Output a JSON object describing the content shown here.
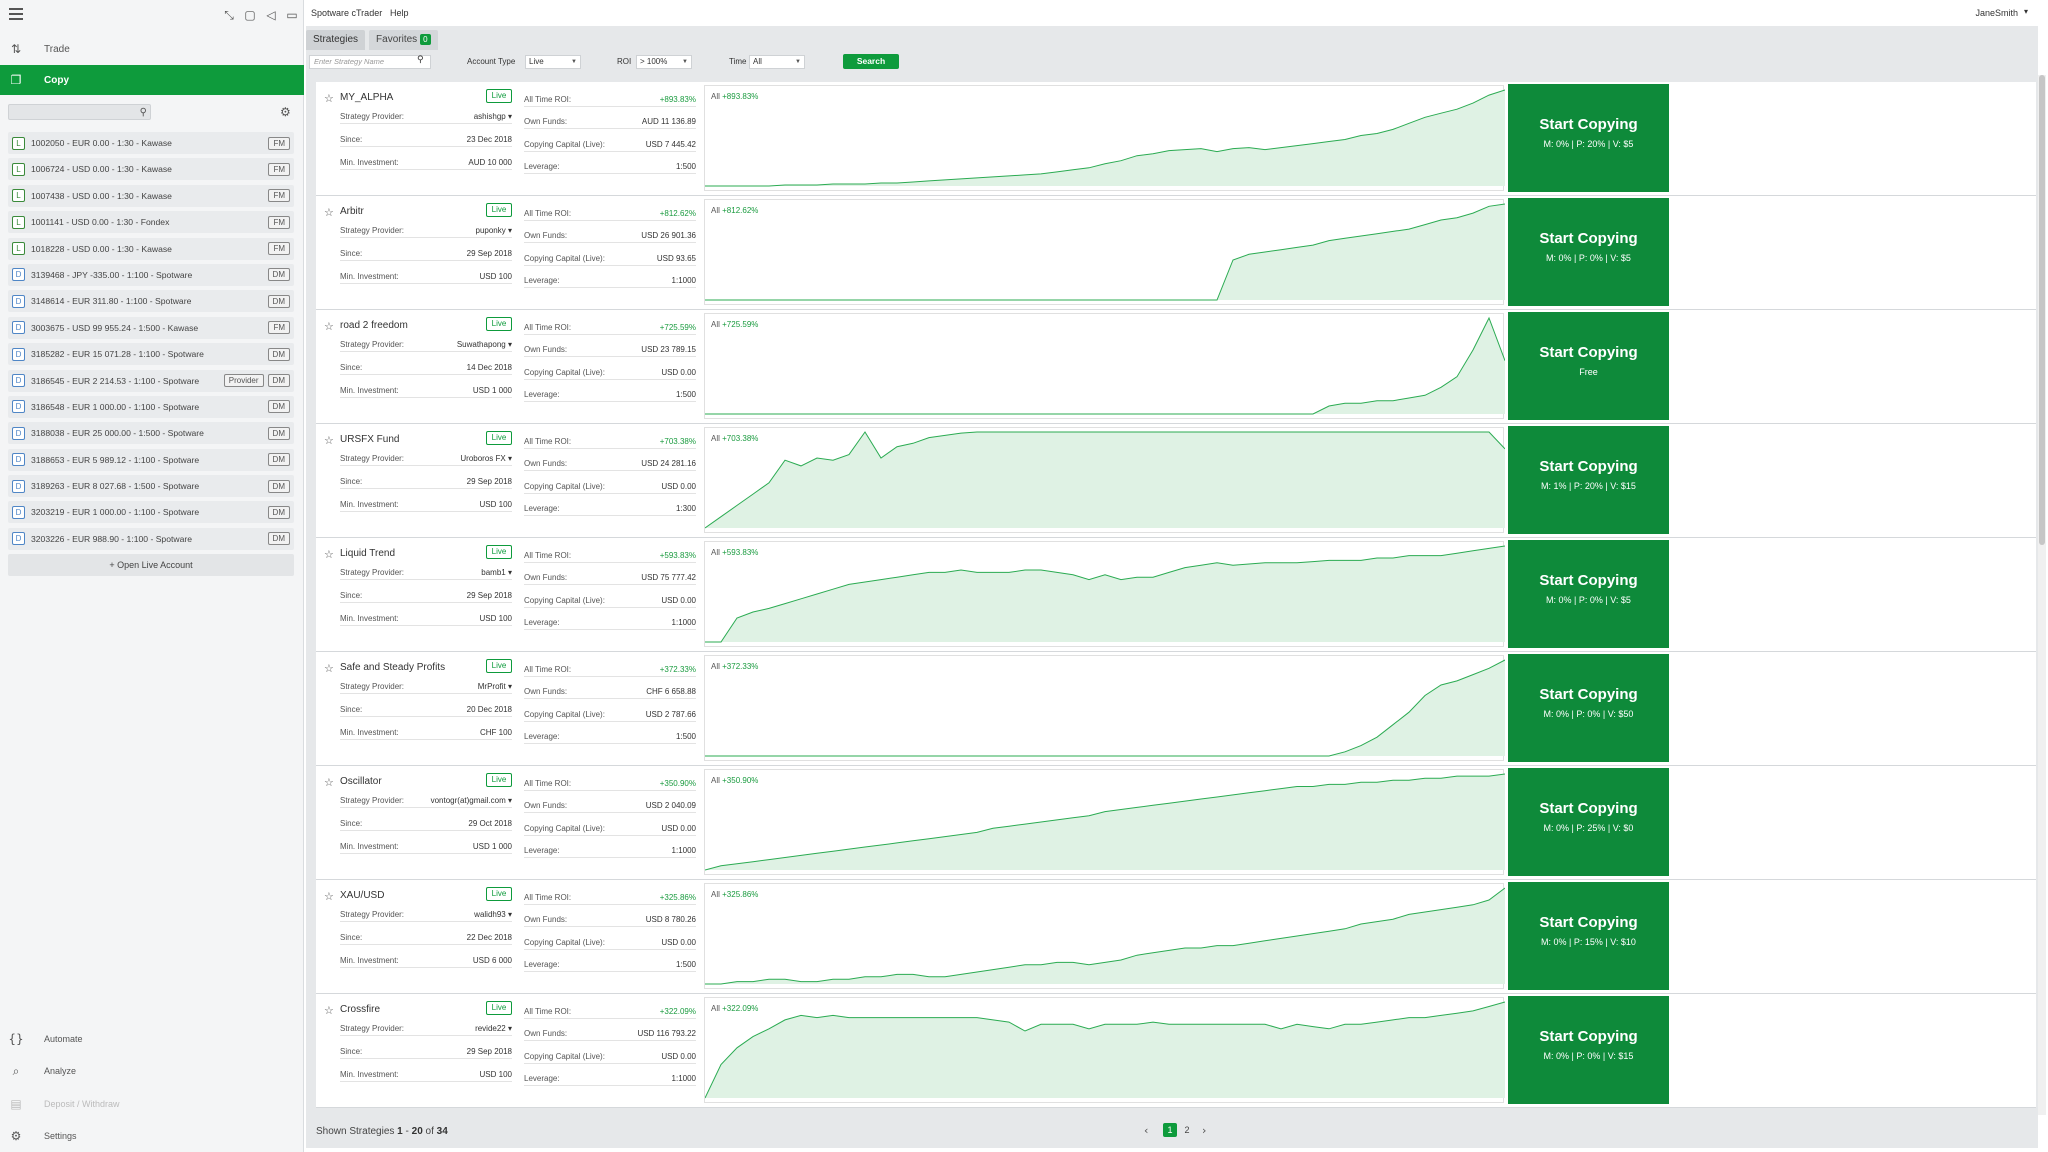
{
  "sidebar": {
    "nav": [
      {
        "label": "Trade",
        "icon": "trade-icon"
      },
      {
        "label": "Copy",
        "icon": "copy-icon"
      }
    ],
    "accounts": [
      {
        "badge": "L",
        "text": "1002050 - EUR 0.00 - 1:30 - Kawase",
        "tag": "FM"
      },
      {
        "badge": "L",
        "text": "1006724 - USD 0.00 - 1:30 - Kawase",
        "tag": "FM"
      },
      {
        "badge": "L",
        "text": "1007438 - USD 0.00 - 1:30 - Kawase",
        "tag": "FM"
      },
      {
        "badge": "L",
        "text": "1001141 - USD 0.00 - 1:30 - Fondex",
        "tag": "FM"
      },
      {
        "badge": "L",
        "text": "1018228 - USD 0.00 - 1:30 - Kawase",
        "tag": "FM"
      },
      {
        "badge": "D",
        "text": "3139468 - JPY -335.00 - 1:100 - Spotware",
        "tag": "DM"
      },
      {
        "badge": "D",
        "text": "3148614 - EUR 311.80 - 1:100 - Spotware",
        "tag": "DM"
      },
      {
        "badge": "D",
        "text": "3003675 - USD 99 955.24 - 1:500 - Kawase",
        "tag": "FM"
      },
      {
        "badge": "D",
        "text": "3185282 - EUR 15 071.28 - 1:100 - Spotware",
        "tag": "DM"
      },
      {
        "badge": "D",
        "text": "3186545 - EUR 2 214.53 - 1:100 - Spotware",
        "tag": "DM",
        "extra": "Provider"
      },
      {
        "badge": "D",
        "text": "3186548 - EUR 1 000.00 - 1:100 - Spotware",
        "tag": "DM"
      },
      {
        "badge": "D",
        "text": "3188038 - EUR 25 000.00 - 1:500 - Spotware",
        "tag": "DM"
      },
      {
        "badge": "D",
        "text": "3188653 - EUR 5 989.12 - 1:100 - Spotware",
        "tag": "DM"
      },
      {
        "badge": "D",
        "text": "3189263 - EUR 8 027.68 - 1:500 - Spotware",
        "tag": "DM"
      },
      {
        "badge": "D",
        "text": "3203219 - EUR 1 000.00 - 1:100 - Spotware",
        "tag": "DM"
      },
      {
        "badge": "D",
        "text": "3203226 - EUR 988.90 - 1:100 - Spotware",
        "tag": "DM"
      }
    ],
    "open_live": "+ Open Live Account",
    "bottom_nav": [
      {
        "label": "Automate",
        "icon": "automate-icon"
      },
      {
        "label": "Analyze",
        "icon": "analyze-icon"
      },
      {
        "label": "Deposit / Withdraw",
        "icon": "deposit-icon"
      },
      {
        "label": "Settings",
        "icon": "settings-icon"
      }
    ]
  },
  "header": {
    "app_title": "Spotware cTrader",
    "help": "Help",
    "user": "JaneSmith"
  },
  "tabs": {
    "strategies": "Strategies",
    "favorites": "Favorites",
    "favorites_count": "0"
  },
  "filters": {
    "name_placeholder": "Enter Strategy Name",
    "account_type_label": "Account Type",
    "account_type_value": "Live",
    "roi_label": "ROI",
    "roi_value": "> 100%",
    "time_label": "Time",
    "time_value": "All",
    "search_label": "Search"
  },
  "labels": {
    "provider": "Strategy Provider:",
    "since": "Since:",
    "min_investment": "Min. Investment:",
    "roi": "All Time ROI:",
    "own_funds": "Own Funds:",
    "copying_capital": "Copying Capital (Live):",
    "leverage": "Leverage:",
    "start_copying": "Start Copying",
    "live": "Live",
    "chart_prefix": "All"
  },
  "strategies": [
    {
      "name": "MY_ALPHA",
      "provider": "ashishgp",
      "since": "23 Dec 2018",
      "min_investment": "AUD 10 000",
      "roi": "+893.83%",
      "own_funds": "AUD 11 136.89",
      "copying_capital": "USD 7 445.42",
      "leverage": "1:500",
      "fees": "M: 0% | P: 20% | V: $5",
      "chart_data": {
        "type": "area",
        "values": [
          0,
          0,
          0,
          0,
          0,
          1,
          1,
          1,
          2,
          2,
          2,
          3,
          3,
          4,
          5,
          6,
          7,
          8,
          9,
          10,
          11,
          12,
          14,
          16,
          18,
          22,
          25,
          30,
          32,
          35,
          36,
          37,
          34,
          37,
          38,
          36,
          38,
          40,
          42,
          44,
          46,
          50,
          52,
          56,
          62,
          68,
          72,
          76,
          82,
          90,
          95
        ]
      }
    },
    {
      "name": "Arbitr",
      "provider": "puponky",
      "since": "29 Sep 2018",
      "min_investment": "USD 100",
      "roi": "+812.62%",
      "own_funds": "USD 26 901.36",
      "copying_capital": "USD 93.65",
      "leverage": "1:1000",
      "fees": "M: 0% | P: 0% | V: $5",
      "chart_data": {
        "type": "area",
        "values": [
          0,
          0,
          0,
          0,
          0,
          0,
          0,
          0,
          0,
          0,
          0,
          0,
          0,
          0,
          0,
          0,
          0,
          0,
          0,
          0,
          0,
          0,
          0,
          0,
          0,
          0,
          0,
          0,
          0,
          0,
          0,
          0,
          0,
          35,
          40,
          42,
          44,
          46,
          48,
          52,
          54,
          56,
          58,
          60,
          62,
          66,
          70,
          72,
          76,
          82,
          84
        ]
      }
    },
    {
      "name": "road 2 freedom",
      "provider": "Suwathapong",
      "since": "14 Dec 2018",
      "min_investment": "USD 1 000",
      "roi": "+725.59%",
      "own_funds": "USD 23 789.15",
      "copying_capital": "USD 0.00",
      "leverage": "1:500",
      "fees": "Free",
      "chart_data": {
        "type": "area",
        "values": [
          0,
          0,
          0,
          0,
          0,
          0,
          0,
          0,
          0,
          0,
          0,
          0,
          0,
          0,
          0,
          0,
          0,
          0,
          0,
          0,
          0,
          0,
          0,
          0,
          0,
          0,
          0,
          0,
          0,
          0,
          0,
          0,
          0,
          0,
          0,
          0,
          0,
          0,
          0,
          6,
          8,
          8,
          10,
          10,
          12,
          14,
          20,
          28,
          48,
          72,
          40
        ]
      }
    },
    {
      "name": "URSFX Fund",
      "provider": "Uroboros FX",
      "since": "29 Sep 2018",
      "min_investment": "USD 100",
      "roi": "+703.38%",
      "own_funds": "USD 24 281.16",
      "copying_capital": "USD 0.00",
      "leverage": "1:300",
      "fees": "M: 1% | P: 20% | V: $15",
      "chart_data": {
        "type": "area",
        "values": [
          0,
          10,
          20,
          30,
          40,
          60,
          55,
          62,
          60,
          65,
          85,
          62,
          72,
          75,
          80,
          82,
          84,
          85,
          85,
          85,
          85,
          85,
          85,
          85,
          85,
          85,
          85,
          85,
          85,
          85,
          85,
          85,
          85,
          85,
          85,
          85,
          85,
          85,
          85,
          85,
          85,
          85,
          85,
          85,
          85,
          85,
          85,
          85,
          85,
          85,
          70
        ]
      }
    },
    {
      "name": "Liquid Trend",
      "provider": "bamb1",
      "since": "29 Sep 2018",
      "min_investment": "USD 100",
      "roi": "+593.83%",
      "own_funds": "USD 75 777.42",
      "copying_capital": "USD 0.00",
      "leverage": "1:1000",
      "fees": "M: 0% | P: 0% | V: $5",
      "chart_data": {
        "type": "area",
        "values": [
          0,
          0,
          20,
          25,
          28,
          32,
          36,
          40,
          44,
          48,
          50,
          52,
          54,
          56,
          58,
          58,
          60,
          58,
          58,
          58,
          60,
          60,
          58,
          56,
          52,
          56,
          52,
          54,
          54,
          58,
          62,
          64,
          66,
          64,
          65,
          66,
          66,
          66,
          67,
          68,
          68,
          68,
          70,
          70,
          72,
          72,
          72,
          74,
          76,
          78,
          80
        ]
      }
    },
    {
      "name": "Safe and Steady Profits",
      "provider": "MrProfit",
      "since": "20 Dec 2018",
      "min_investment": "CHF 100",
      "roi": "+372.33%",
      "own_funds": "CHF 6 658.88",
      "copying_capital": "USD 2 787.66",
      "leverage": "1:500",
      "fees": "M: 0% | P: 0% | V: $50",
      "chart_data": {
        "type": "area",
        "values": [
          0,
          0,
          0,
          0,
          0,
          0,
          0,
          0,
          0,
          0,
          0,
          0,
          0,
          0,
          0,
          0,
          0,
          0,
          0,
          0,
          0,
          0,
          0,
          0,
          0,
          0,
          0,
          0,
          0,
          0,
          0,
          0,
          0,
          0,
          0,
          0,
          0,
          0,
          0,
          0,
          4,
          10,
          18,
          30,
          42,
          58,
          68,
          72,
          78,
          84,
          92
        ]
      }
    },
    {
      "name": "Oscillator",
      "provider": "vontogr(at)gmail.com",
      "since": "29 Oct 2018",
      "min_investment": "USD 1 000",
      "roi": "+350.90%",
      "own_funds": "USD 2 040.09",
      "copying_capital": "USD 0.00",
      "leverage": "1:1000",
      "fees": "M: 0% | P: 25% | V: $0",
      "chart_data": {
        "type": "area",
        "values": [
          0,
          4,
          6,
          8,
          10,
          12,
          14,
          16,
          18,
          20,
          22,
          24,
          26,
          28,
          30,
          32,
          34,
          36,
          40,
          42,
          44,
          46,
          48,
          50,
          52,
          56,
          58,
          60,
          62,
          64,
          66,
          68,
          70,
          72,
          74,
          76,
          78,
          80,
          80,
          82,
          82,
          84,
          84,
          86,
          86,
          88,
          88,
          90,
          90,
          90,
          92
        ]
      }
    },
    {
      "name": "XAU/USD",
      "provider": "walidh93",
      "since": "22 Dec 2018",
      "min_investment": "USD 6 000",
      "roi": "+325.86%",
      "own_funds": "USD 8 780.26",
      "copying_capital": "USD 0.00",
      "leverage": "1:500",
      "fees": "M: 0% | P: 15% | V: $10",
      "chart_data": {
        "type": "area",
        "values": [
          0,
          0,
          2,
          2,
          4,
          4,
          2,
          2,
          4,
          4,
          6,
          6,
          8,
          8,
          6,
          6,
          8,
          10,
          12,
          14,
          16,
          16,
          18,
          18,
          16,
          18,
          20,
          24,
          26,
          28,
          30,
          30,
          32,
          32,
          34,
          36,
          38,
          40,
          42,
          44,
          46,
          50,
          52,
          54,
          58,
          60,
          62,
          64,
          66,
          70,
          80
        ]
      }
    },
    {
      "name": "Crossfire",
      "provider": "revide22",
      "since": "29 Sep 2018",
      "min_investment": "USD 100",
      "roi": "+322.09%",
      "own_funds": "USD 116 793.22",
      "copying_capital": "USD 0.00",
      "leverage": "1:1000",
      "fees": "M: 0% | P: 0% | V: $15",
      "chart_data": {
        "type": "area",
        "values": [
          0,
          30,
          45,
          55,
          62,
          70,
          74,
          72,
          74,
          72,
          72,
          72,
          72,
          72,
          72,
          72,
          72,
          72,
          70,
          68,
          60,
          66,
          66,
          66,
          62,
          66,
          66,
          66,
          68,
          66,
          66,
          66,
          66,
          66,
          66,
          66,
          62,
          66,
          64,
          62,
          66,
          66,
          68,
          70,
          72,
          72,
          74,
          76,
          78,
          82,
          86
        ]
      }
    }
  ],
  "pager": {
    "shown_prefix": "Shown Strategies",
    "from": "1",
    "to": "20",
    "of_word": "of",
    "total": "34",
    "dash": "-",
    "pages": [
      "1",
      "2"
    ]
  }
}
